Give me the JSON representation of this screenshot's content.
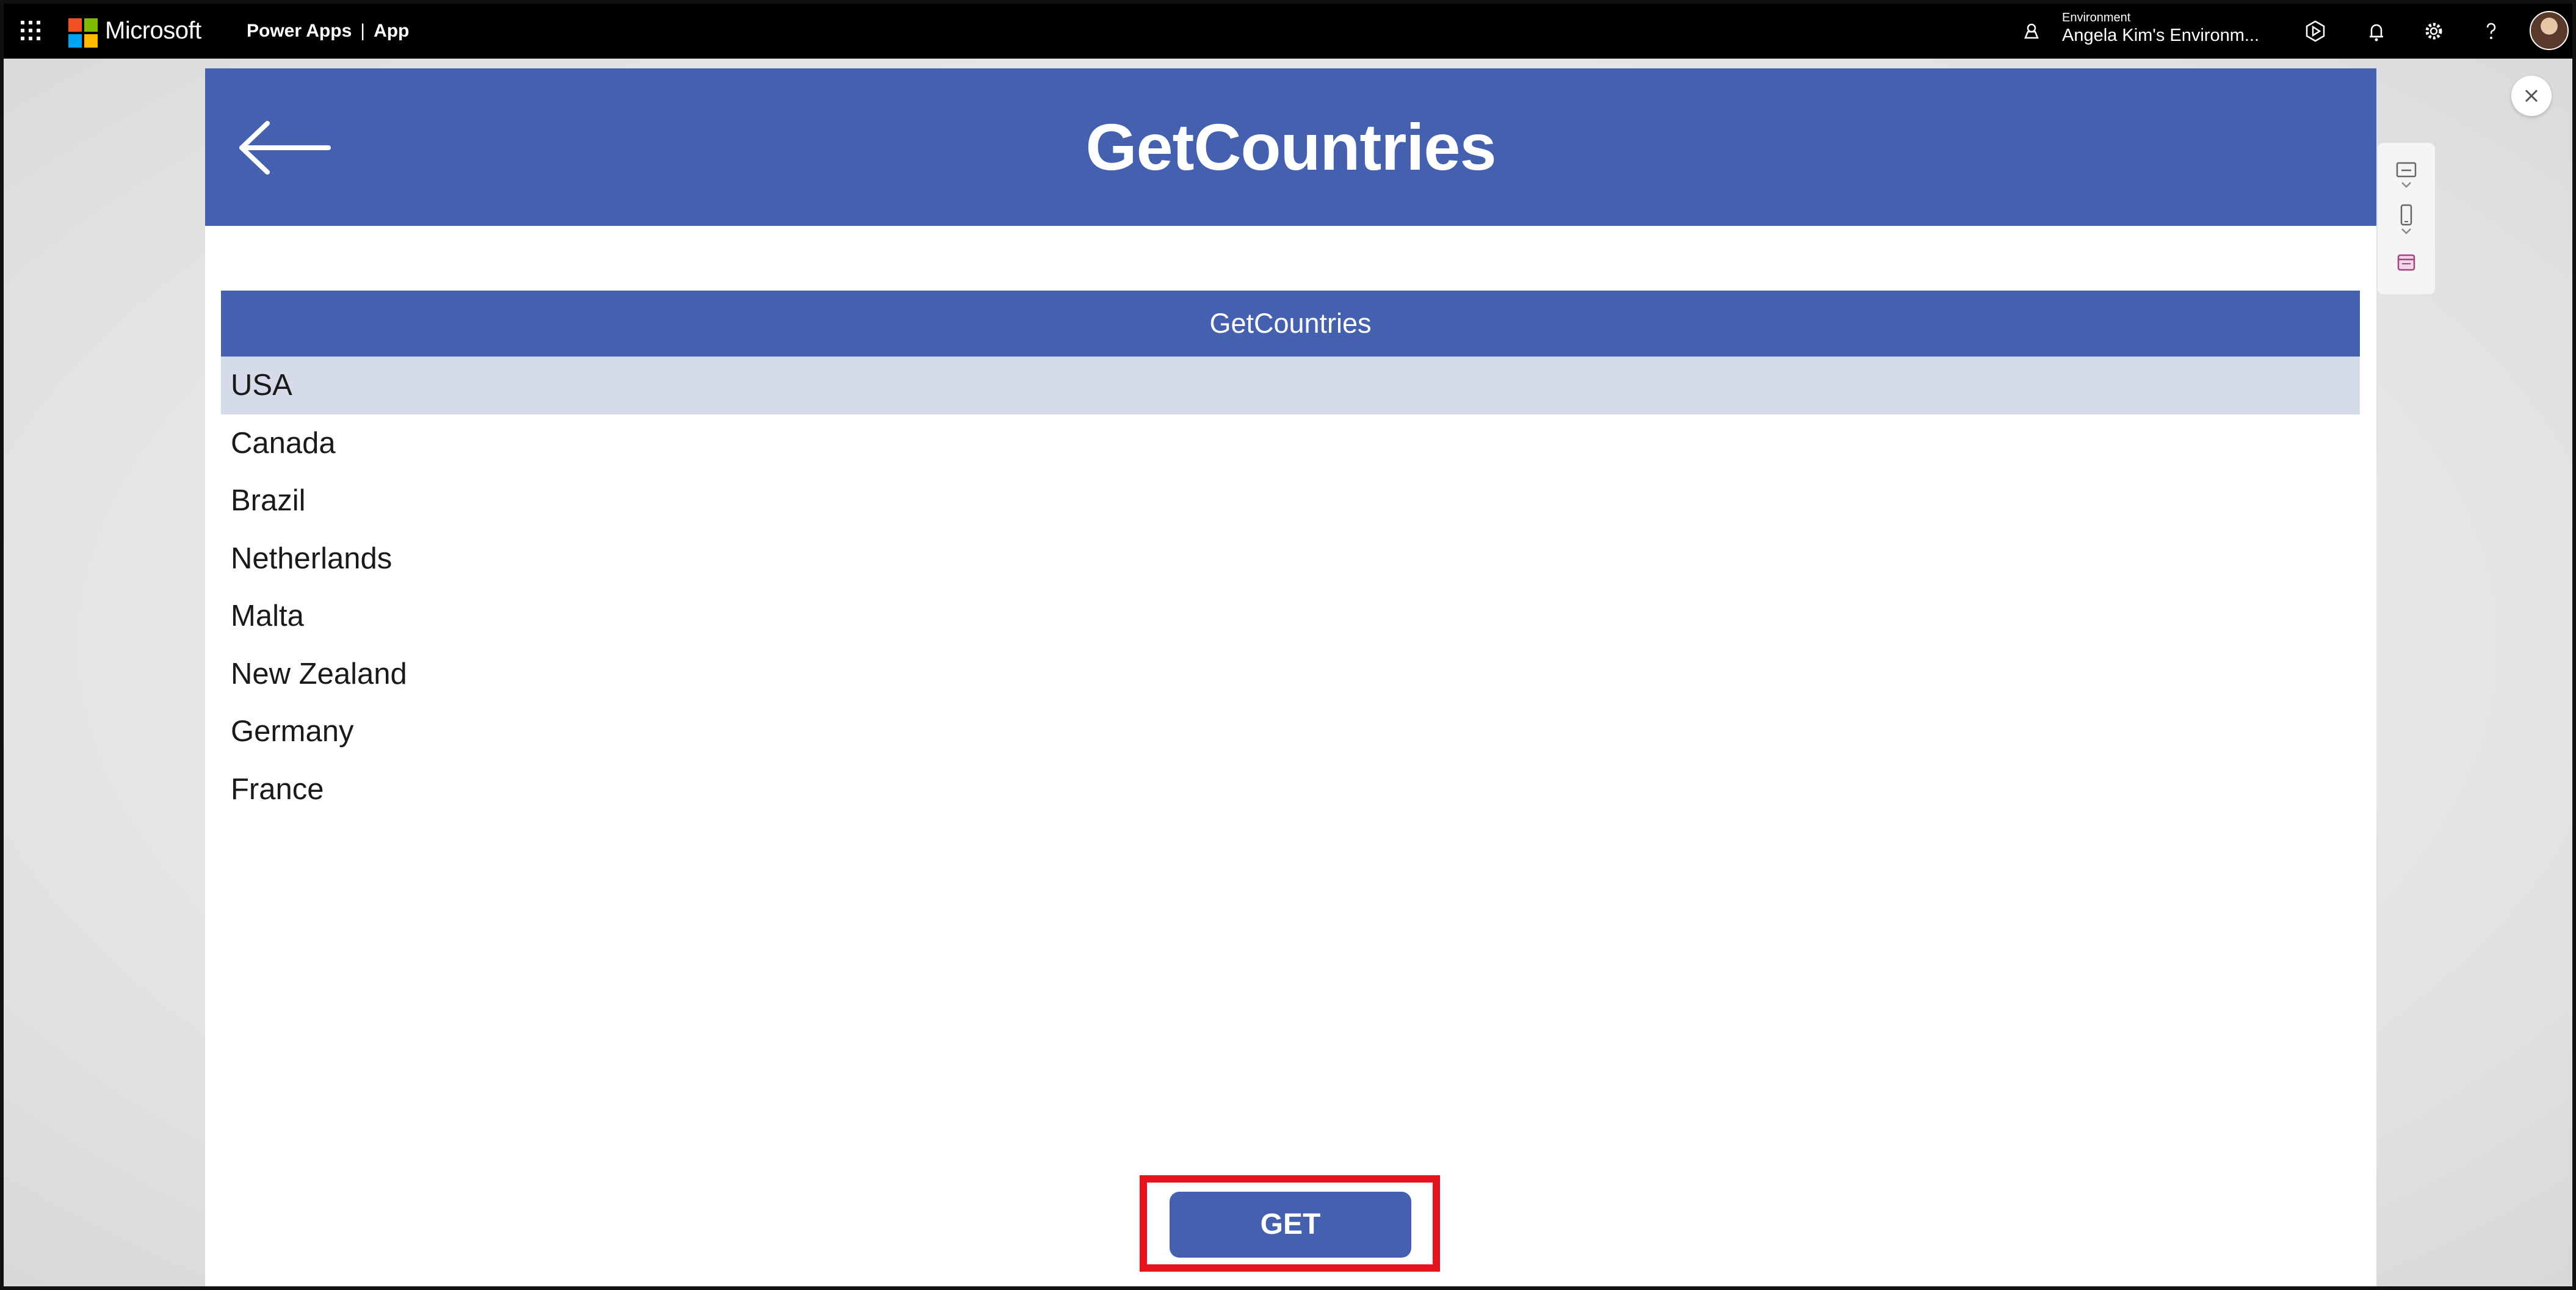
{
  "topbar": {
    "brand": "Microsoft",
    "product": "Power Apps",
    "separator": "|",
    "app_label": "App",
    "environment_caption": "Environment",
    "environment_name": "Angela Kim's Environm...",
    "icons": [
      "app-launcher-icon",
      "microsoft-logo-icon",
      "environment-icon",
      "play-icon",
      "notifications-icon",
      "settings-icon",
      "help-icon",
      "avatar"
    ]
  },
  "screen": {
    "title": "GetCountries",
    "back_icon": "back-arrow-icon"
  },
  "gallery": {
    "header": "GetCountries",
    "selected_index": 0,
    "items": [
      "USA",
      "Canada",
      "Brazil",
      "Netherlands",
      "Malta",
      "New Zealand",
      "Germany",
      "France"
    ]
  },
  "actions": {
    "get_label": "GET",
    "highlight_color": "#e8141d"
  },
  "side_tools": {
    "icons": [
      "screen-size-icon",
      "chevron-down-icon",
      "phone-icon",
      "chevron-down-icon",
      "calendar-icon"
    ]
  },
  "colors": {
    "accent": "#4460ae",
    "selected_row": "#d6dbea",
    "topbar": "#000000"
  }
}
